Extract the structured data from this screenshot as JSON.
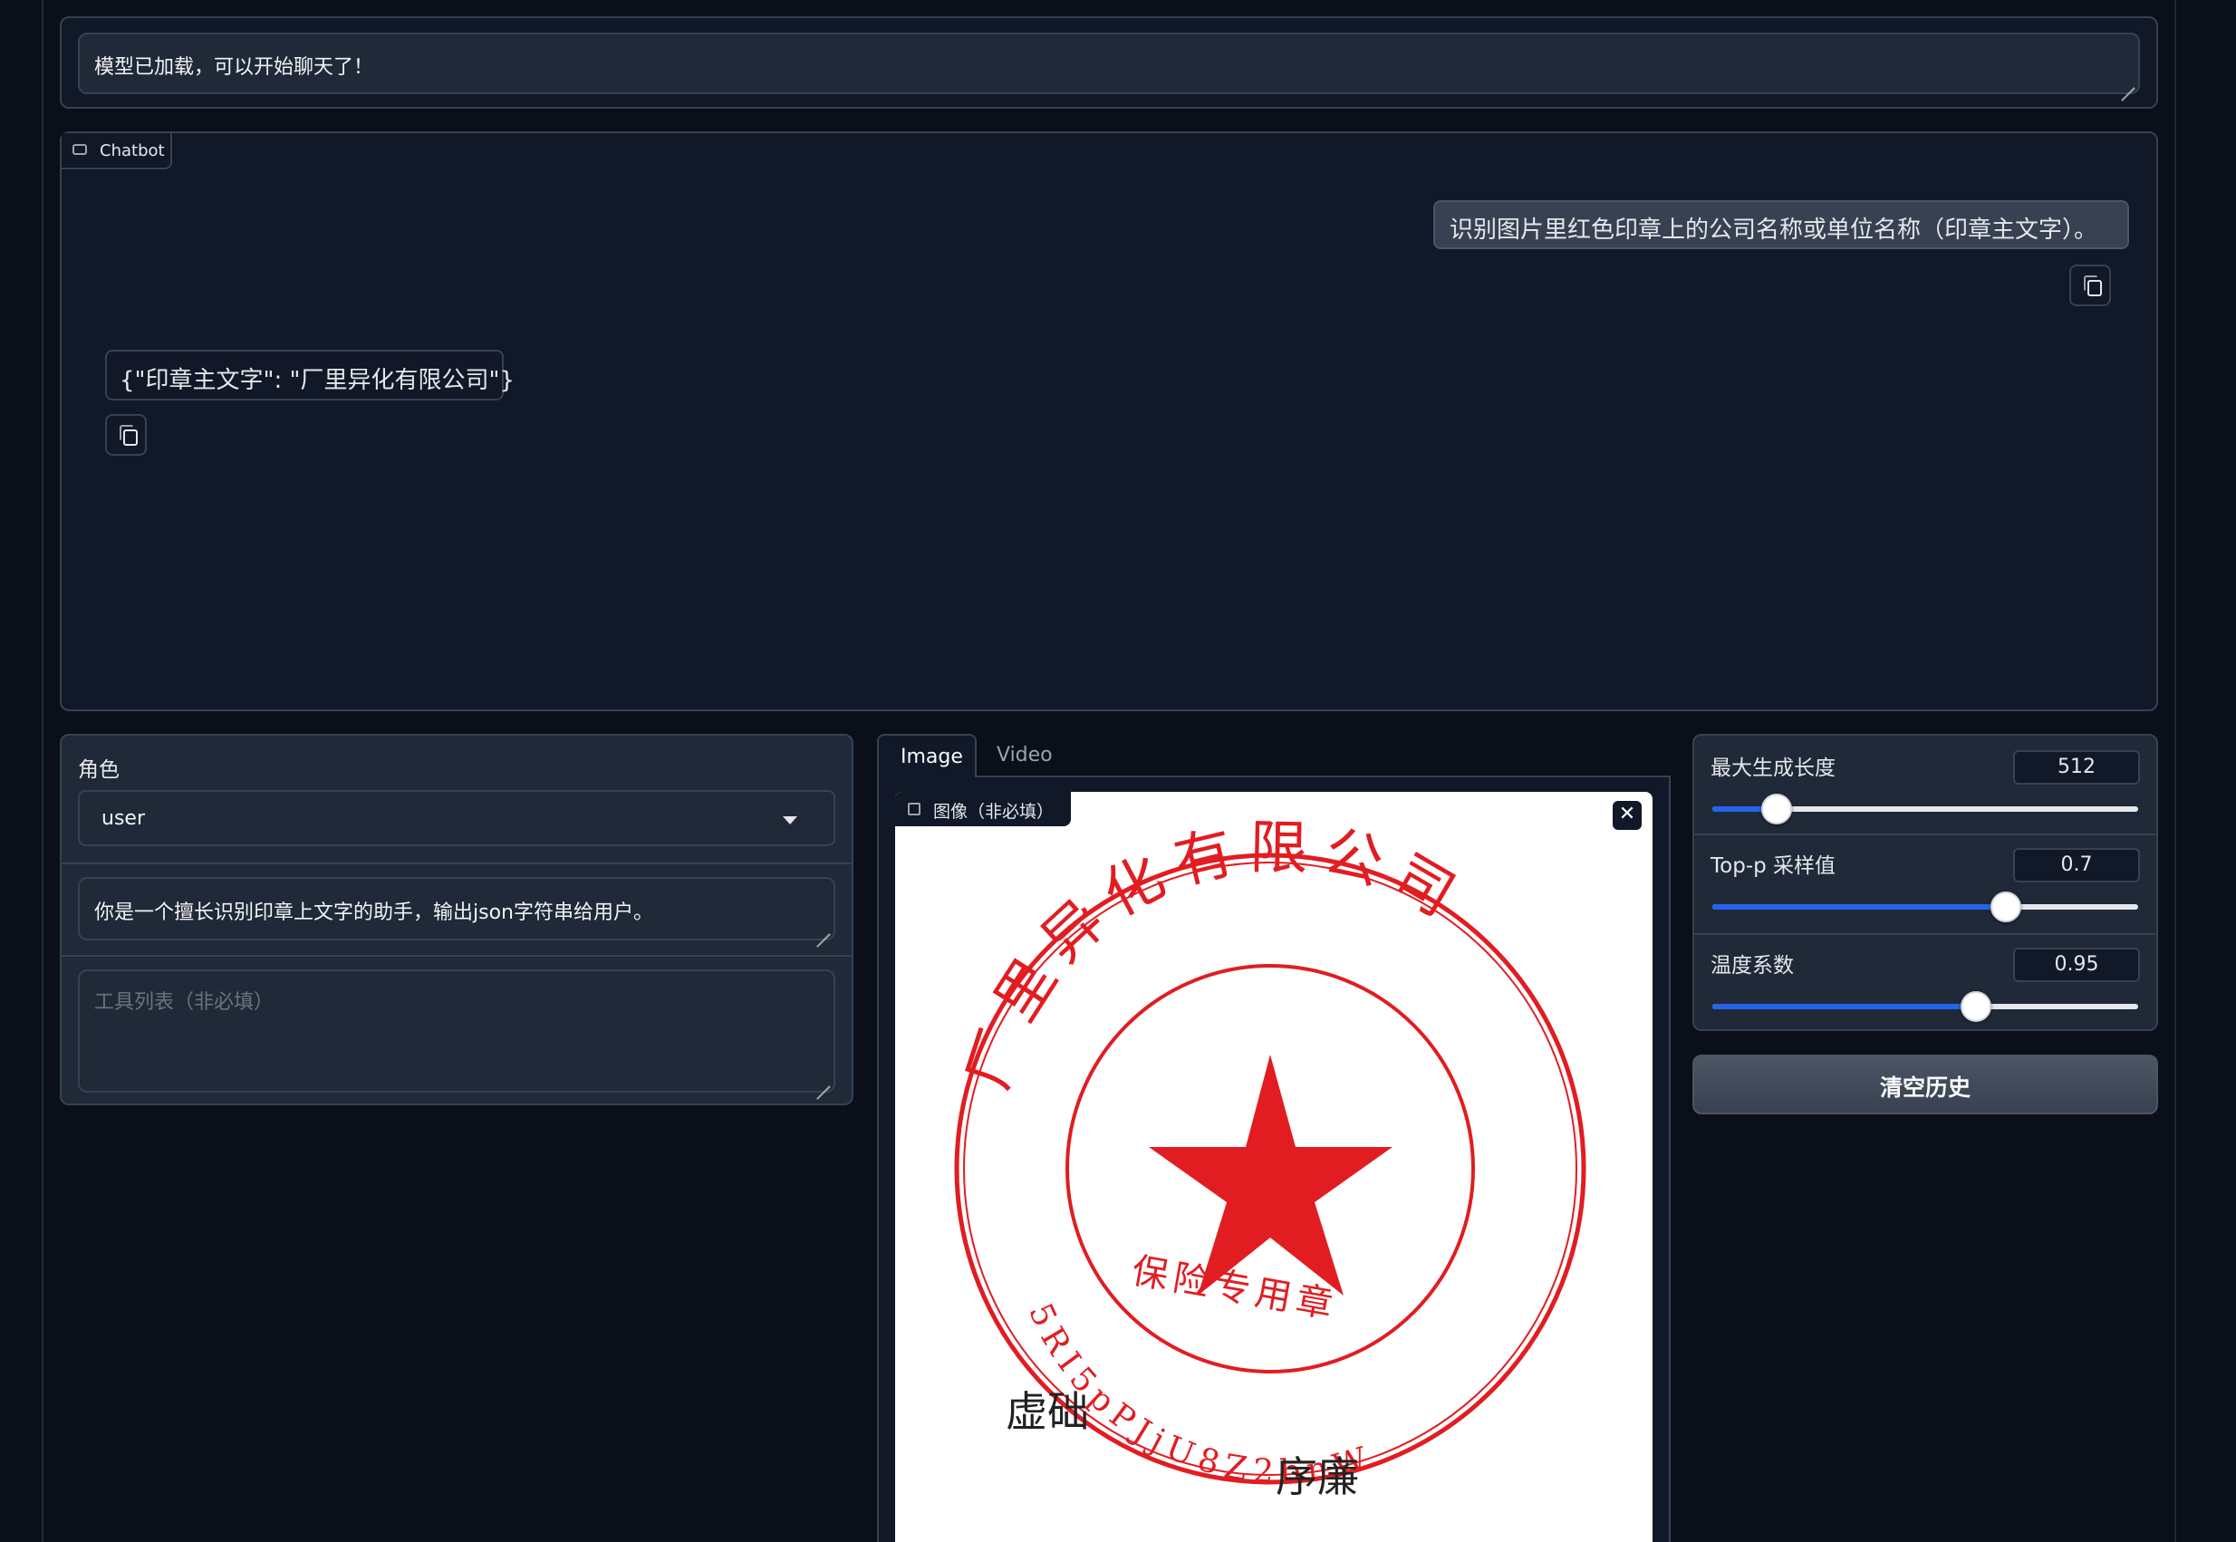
{
  "status": {
    "text": "模型已加载，可以开始聊天了！"
  },
  "chatbot": {
    "label": "Chatbot",
    "messages": [
      {
        "role": "user",
        "text": "识别图片里红色印章上的公司名称或单位名称（印章主文字）。"
      },
      {
        "role": "assistant",
        "text": "{\"印章主文字\": \"厂里异化有限公司\"}"
      }
    ]
  },
  "left": {
    "role_label": "角色",
    "role_value": "user",
    "system_prompt": "你是一个擅长识别印章上文字的助手，输出json字符串给用户。",
    "tools_placeholder": "工具列表（非必填）"
  },
  "media": {
    "tabs": [
      {
        "label": "Image",
        "active": true
      },
      {
        "label": "Video",
        "active": false
      }
    ],
    "image_label": "图像（非必填）",
    "stamp": {
      "company": "厂里异化有限公司",
      "purpose": "保险专用章",
      "serial": "5RI5pPJjU8Z2bnW",
      "scribble_1": "虚础",
      "scribble_2": "序廉",
      "color": "#e11d22"
    }
  },
  "params": {
    "max_len": {
      "label": "最大生成长度",
      "value": "512",
      "level": 0.15
    },
    "top_p": {
      "label": "Top-p 采样值",
      "value": "0.7",
      "level": 0.69
    },
    "temperature": {
      "label": "温度系数",
      "value": "0.95",
      "level": 0.62
    }
  },
  "actions": {
    "clear_label": "清空历史"
  },
  "colors": {
    "background": "#0b0f19",
    "panel": "#111827",
    "field": "#1f2937",
    "accent": "#2563eb",
    "stamp_red": "#e11d22"
  }
}
